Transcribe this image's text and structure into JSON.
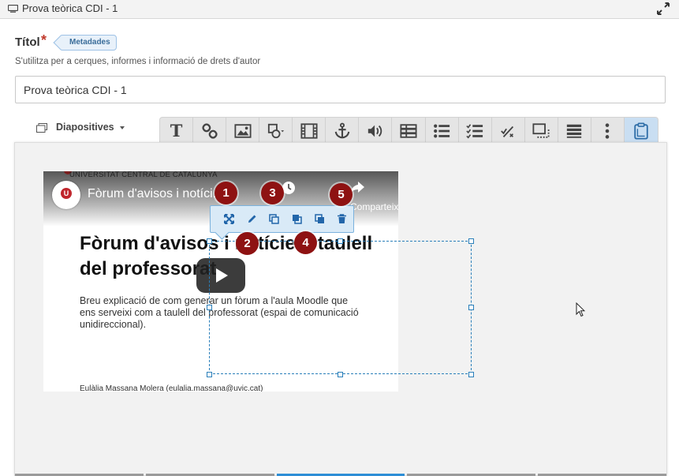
{
  "window": {
    "title": "Prova teòrica CDI - 1",
    "icons": {
      "window": "monitor-icon",
      "expand": "expand-icon"
    }
  },
  "form": {
    "label": "Títol",
    "required_mark": "*",
    "metadata_badge": "Metadades",
    "help": "S'utilitza per a cerques, informes i informació de drets d'autor",
    "title_value": "Prova teòrica CDI - 1"
  },
  "editor": {
    "slides_dropdown": "Diapositives",
    "toolbar": [
      "text-icon",
      "link-icon",
      "image-icon",
      "shapes-icon",
      "video-icon",
      "anchor-icon",
      "audio-icon",
      "table-icon",
      "list-icon",
      "checklist-icon",
      "percent-icon",
      "overlay-icon",
      "rows-icon",
      "more-icon",
      "paste-icon"
    ]
  },
  "video": {
    "org": "UNIVERSITAT CENTRAL DE CATALUNYA",
    "title": "Fòrum d'avisos i notíci...",
    "share_label": "Comparteix",
    "slide_heading": "Fòrum d'avisos i notícies: taulell del professorat",
    "slide_text": "Breu explicació de com generar un fòrum a l'aula Moodle que ens serveixi com a taulell del professorat (espai de comunicació unidireccional).",
    "slide_footer": "Eulàlia Massana Molera (eulalia.massana@uvic.cat)"
  },
  "element_toolbar": [
    "fullscreen-icon",
    "edit-icon",
    "copy-icon",
    "send-back-icon",
    "bring-front-icon",
    "delete-icon"
  ],
  "markers": [
    "1",
    "2",
    "3",
    "4",
    "5"
  ],
  "colors": {
    "marker": "#8e1212",
    "selection": "#2a7fba",
    "active_tab": "#2d8ed6",
    "required": "#c0392b"
  }
}
